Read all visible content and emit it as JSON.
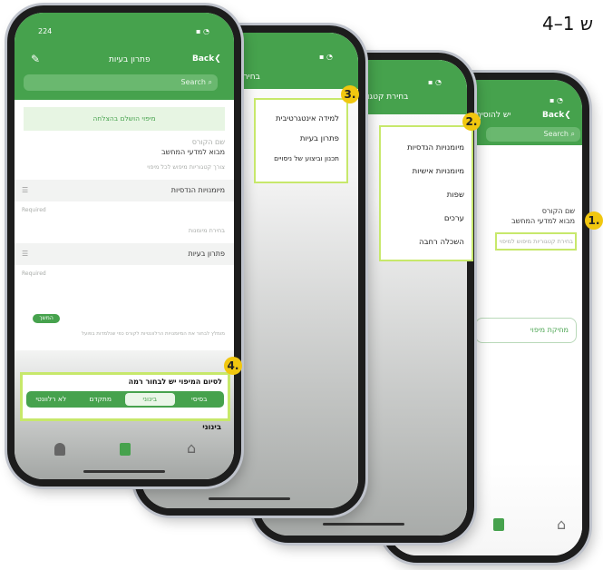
{
  "page_label": "4–1 ש",
  "badges": [
    "1.",
    "2.",
    "3.",
    "4."
  ],
  "accent": "#46a24d",
  "highlight": "#c7e86b",
  "phone1": {
    "time": "224",
    "title": "פתרון בעיות",
    "back": "Back",
    "search": "Search",
    "banner": "מיפוי הושלם בהצלחה",
    "course_label": "שם הקורס",
    "course_value": "מבוא למדעי המחשב",
    "section_hint": "צורך קטגוריות מיפוש לכל מיפוי",
    "category_value": "מיומנויות הנדסיות",
    "required": "Required",
    "subcat_hint": "בחירת מיומנות",
    "subcat_value": "פתרון בעיות",
    "required2": "Required",
    "chip": "המשך",
    "note": "מומלץ לבחור את המיומנויות הרלוונטיות לקורס כפי שנלמדות בפועל",
    "level_prompt": "לסיום המיפוי יש לבחור רמה",
    "levels": [
      "בסיסי",
      "בינוני",
      "מתקדם",
      "לא רלוונטי"
    ],
    "selected_level": "בינוני",
    "bottom_text": "בינוני"
  },
  "phone2": {
    "title": "בחירת תת",
    "menu": [
      "למידה אינטגרטיבית",
      "פתרון בעיות",
      "תכנון וביצוע של ניסויים"
    ]
  },
  "phone3": {
    "title": "בחירת קטגוריה",
    "menu": [
      "מיומנויות הנדסיות",
      "מיומנויות אישיות",
      "שפות",
      "ערכים",
      "השכלה רחבה"
    ]
  },
  "phone4": {
    "title": "יש להוסיף מ",
    "back": "Back",
    "search": "Search",
    "course_label": "שם הקורס",
    "course_value": "מבוא למדעי המחשב",
    "select_hint": "בחירת קטגוריות מיפוש למיפוי",
    "button": "מחיקת מיפוי"
  }
}
